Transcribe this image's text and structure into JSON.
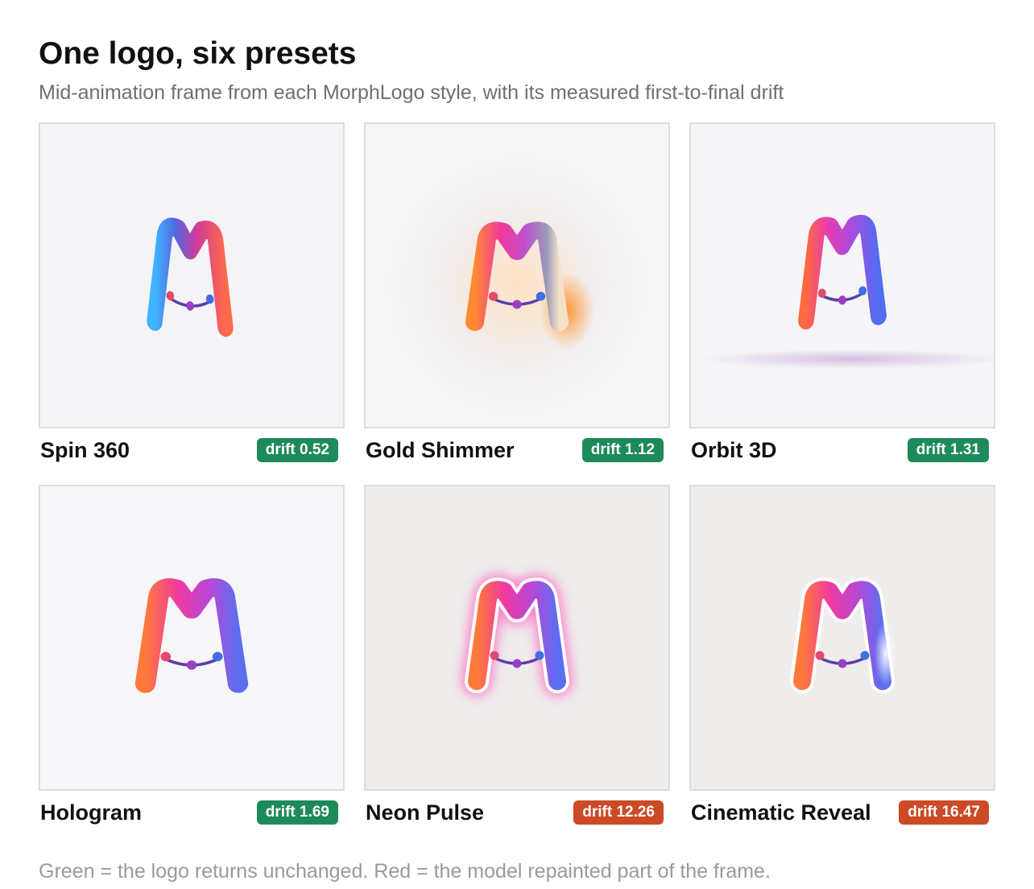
{
  "header": {
    "title": "One logo, six presets",
    "subtitle": "Mid-animation frame from each MorphLogo style, with its measured first-to-final drift"
  },
  "status_colors": {
    "unchanged": "#1d8a5a",
    "repainted": "#cc4a25"
  },
  "presets": [
    {
      "name": "Spin 360",
      "drift_label": "drift 0.52",
      "drift": 0.52,
      "status": "unchanged",
      "style": "spin"
    },
    {
      "name": "Gold Shimmer",
      "drift_label": "drift 1.12",
      "drift": 1.12,
      "status": "unchanged",
      "style": "shimmer"
    },
    {
      "name": "Orbit 3D",
      "drift_label": "drift 1.31",
      "drift": 1.31,
      "status": "unchanged",
      "style": "orbit"
    },
    {
      "name": "Hologram",
      "drift_label": "drift 1.69",
      "drift": 1.69,
      "status": "unchanged",
      "style": "hologram"
    },
    {
      "name": "Neon Pulse",
      "drift_label": "drift 12.26",
      "drift": 12.26,
      "status": "repainted",
      "style": "neon"
    },
    {
      "name": "Cinematic Reveal",
      "drift_label": "drift 16.47",
      "drift": 16.47,
      "status": "repainted",
      "style": "cinematic"
    }
  ],
  "footer": {
    "legend": "Green = the logo returns unchanged. Red = the model repainted part of the frame."
  }
}
